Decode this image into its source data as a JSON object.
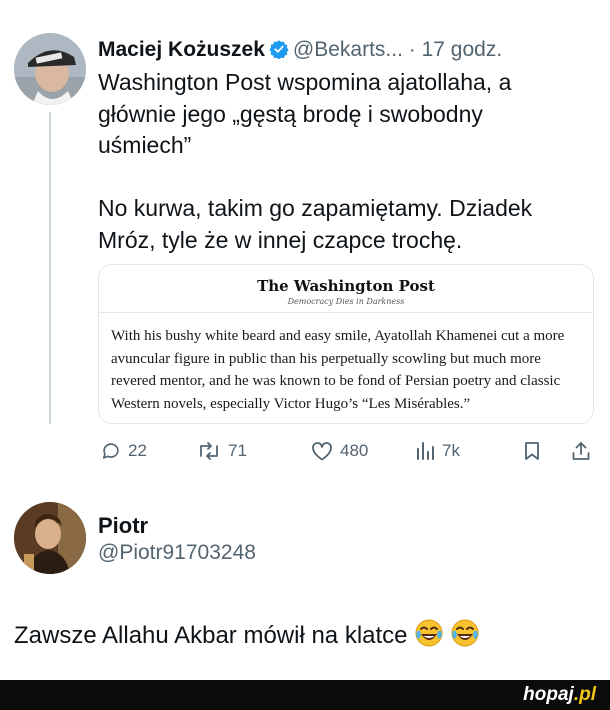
{
  "tweet": {
    "author_name": "Maciej Kożuszek",
    "handle": "@Bekarts...",
    "separator": "·",
    "time": "17 godz.",
    "text": "Washington Post wspomina ajatollaha, a głównie jego „gęstą brodę i swobodny uśmiech”\n\nNo kurwa, takim go zapamiętamy. Dziadek Mróz, tyle że w innej czapce trochę.",
    "icons": {
      "verified": "verified-badge-icon",
      "avatar": "avatar"
    },
    "colors": {
      "verified": "#1d9bf0",
      "muted": "#536471",
      "text": "#0f1419"
    }
  },
  "quoted_card": {
    "logo": "The Washington Post",
    "slogan": "Democracy Dies in Darkness",
    "body": "With his bushy white beard and easy smile, Ayatollah Khamenei cut a more avuncular figure in public than his perpetually scowling but much more revered mentor, and he was known to be fond of Persian poetry and classic Western novels, especially Victor Hugo’s “Les Misérables.”"
  },
  "actions": {
    "replies": "22",
    "reposts": "71",
    "likes": "480",
    "views": "7k",
    "icons": [
      "reply-icon",
      "repost-icon",
      "like-icon",
      "views-icon",
      "bookmark-icon",
      "share-icon"
    ]
  },
  "reply": {
    "author_name": "Piotr",
    "handle": "@Piotr91703248",
    "text": "Zawsze Allahu Akbar mówił na klatce",
    "emoji": [
      "tears-of-joy-emoji",
      "tears-of-joy-emoji"
    ]
  },
  "footer": {
    "brand_name": "hopaj",
    "brand_tld": ".pl",
    "colors": {
      "background": "#0b0b0b",
      "tld": "#f0c419"
    }
  }
}
